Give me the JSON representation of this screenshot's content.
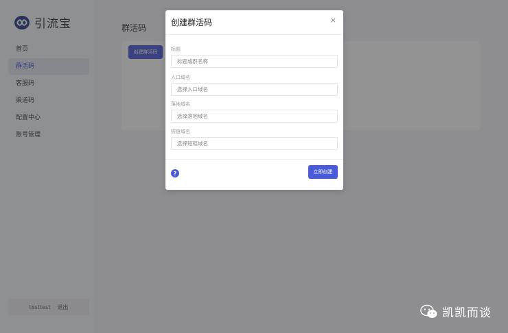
{
  "app": {
    "name": "引流宝"
  },
  "sidebar": {
    "items": [
      {
        "label": "首页",
        "active": false
      },
      {
        "label": "群活码",
        "active": true
      },
      {
        "label": "客服码",
        "active": false
      },
      {
        "label": "渠道码",
        "active": false
      },
      {
        "label": "配置中心",
        "active": false
      },
      {
        "label": "账号管理",
        "active": false
      }
    ],
    "user": {
      "name": "testtest",
      "logout": "退出"
    }
  },
  "main": {
    "title": "群活码",
    "create_button": "创建群活码"
  },
  "modal": {
    "title": "创建群活码",
    "close": "×",
    "fields": [
      {
        "label": "标题",
        "placeholder": "标题或群名称"
      },
      {
        "label": "入口域名",
        "placeholder": "选择入口域名"
      },
      {
        "label": "落地域名",
        "placeholder": "选择落地域名"
      },
      {
        "label": "短链域名",
        "placeholder": "选择短链域名"
      }
    ],
    "help": "?",
    "submit": "立即创建"
  },
  "watermark": {
    "text": "凯凯而谈"
  },
  "colors": {
    "accent": "#4a5bd9",
    "overlay": "rgba(40,40,40,0.5)"
  }
}
